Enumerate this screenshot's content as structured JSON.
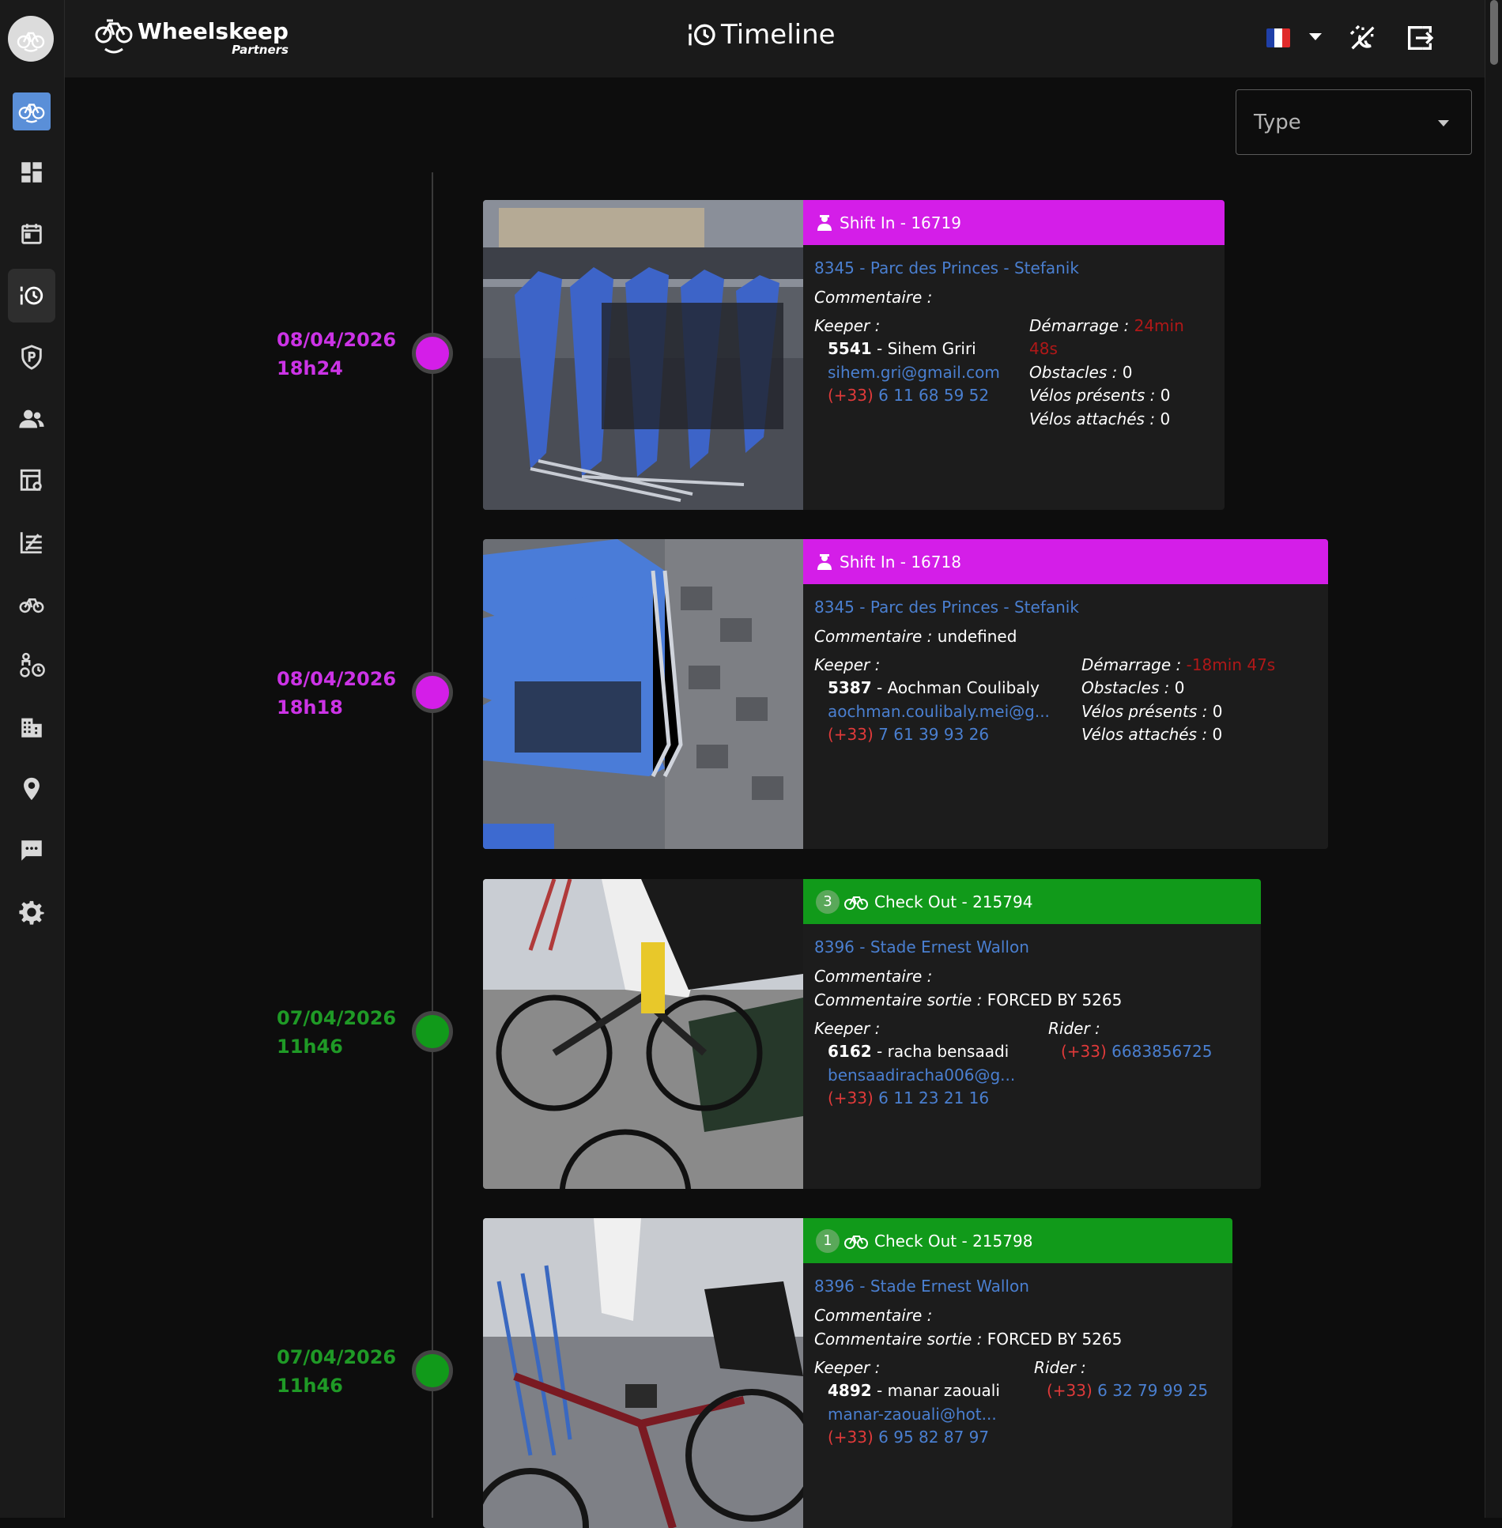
{
  "header": {
    "brand_name": "Wheelskeep",
    "brand_sub": "Partners",
    "page_title": "Timeline",
    "flag_colors": [
      "#1f3fa8",
      "#ffffff",
      "#e02a2a"
    ]
  },
  "filter": {
    "label": "Type"
  },
  "sidebar": {
    "items": [
      {
        "name": "dashboard-icon"
      },
      {
        "name": "calendar-icon"
      },
      {
        "name": "timeline-icon",
        "active": true
      },
      {
        "name": "parking-shield-icon"
      },
      {
        "name": "users-icon"
      },
      {
        "name": "map-sheet-icon"
      },
      {
        "name": "chart-icon"
      },
      {
        "name": "bicycle-icon"
      },
      {
        "name": "keeper-bike-icon"
      },
      {
        "name": "building-icon"
      },
      {
        "name": "location-pin-icon"
      },
      {
        "name": "chat-icon"
      },
      {
        "name": "settings-icon"
      }
    ]
  },
  "colors": {
    "shift_in": "#d41ee8",
    "check_out": "#119a1a",
    "date_shift": "#cc33e6",
    "date_check": "#1f9a26",
    "link": "#4a7fd0",
    "phone_prefix": "#e03a3a"
  },
  "events": [
    {
      "date": "08/04/2026",
      "time": "18h24",
      "header": "Shift In - 16719",
      "location": "8345 - Parc des Princes - Stefanik",
      "comment_label": "Commentaire :",
      "comment_value": "",
      "keeper_label": "Keeper :",
      "keeper_id": "5541",
      "keeper_name": "- Sihem Griri",
      "keeper_email": "sihem.gri@gmail.com",
      "keeper_prefix": "(+33)",
      "keeper_phone": "6 11 68 59 52",
      "start_label": "Démarrage :",
      "start_value_1": "24min",
      "start_value_2": "48s",
      "obstacles_label": "Obstacles :",
      "obstacles_value": "0",
      "bikes_present_label": "Vélos présents :",
      "bikes_present_value": "0",
      "bikes_attached_label": "Vélos attachés :",
      "bikes_attached_value": "0"
    },
    {
      "date": "08/04/2026",
      "time": "18h18",
      "header": "Shift In - 16718",
      "location": "8345 - Parc des Princes - Stefanik",
      "comment_label": "Commentaire :",
      "comment_value": "undefined",
      "keeper_label": "Keeper :",
      "keeper_id": "5387",
      "keeper_name": "- Aochman Coulibaly",
      "keeper_email": "aochman.coulibaly.mei@g...",
      "keeper_prefix": "(+33)",
      "keeper_phone": "7 61 39 93 26",
      "start_label": "Démarrage :",
      "start_value": "-18min 47s",
      "obstacles_label": "Obstacles :",
      "obstacles_value": "0",
      "bikes_present_label": "Vélos présents :",
      "bikes_present_value": "0",
      "bikes_attached_label": "Vélos attachés :",
      "bikes_attached_value": "0"
    },
    {
      "date": "07/04/2026",
      "time": "11h46",
      "badge": "3",
      "header": "Check Out - 215794",
      "location": "8396 - Stade Ernest Wallon",
      "comment_label": "Commentaire :",
      "comment_value": "",
      "exit_comment_label": "Commentaire sortie :",
      "exit_comment_value": "FORCED BY 5265",
      "keeper_label": "Keeper :",
      "keeper_id": "6162",
      "keeper_name": "- racha bensaadi",
      "keeper_email": "bensaadiracha006@g...",
      "keeper_prefix": "(+33)",
      "keeper_phone": "6 11 23 21 16",
      "rider_label": "Rider :",
      "rider_prefix": "(+33)",
      "rider_phone": "6683856725"
    },
    {
      "date": "07/04/2026",
      "time": "11h46",
      "badge": "1",
      "header": "Check Out - 215798",
      "location": "8396 - Stade Ernest Wallon",
      "comment_label": "Commentaire :",
      "comment_value": "",
      "exit_comment_label": "Commentaire sortie :",
      "exit_comment_value": "FORCED BY 5265",
      "keeper_label": "Keeper :",
      "keeper_id": "4892",
      "keeper_name": "- manar zaouali",
      "keeper_email": "manar-zaouali@hot...",
      "keeper_prefix": "(+33)",
      "keeper_phone": "6 95 82 87 97",
      "rider_label": "Rider :",
      "rider_prefix": "(+33)",
      "rider_phone": "6 32 79 99 25"
    }
  ]
}
